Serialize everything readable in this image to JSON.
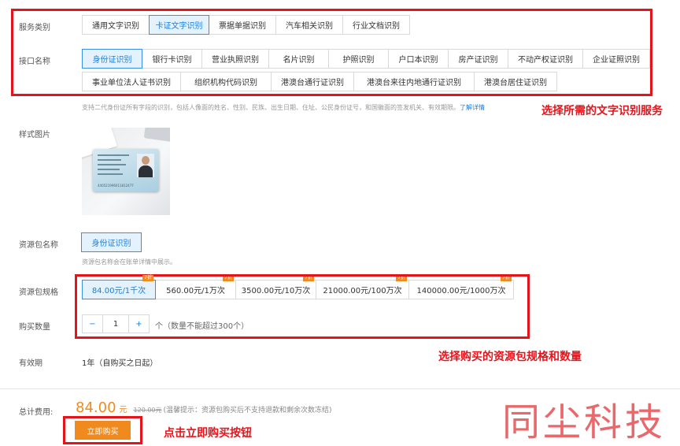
{
  "service_type": {
    "label": "服务类别",
    "tabs": [
      "通用文字识别",
      "卡证文字识别",
      "票据单据识别",
      "汽车相关识别",
      "行业文档识别"
    ],
    "active": 1
  },
  "api_name": {
    "label": "接口名称",
    "row1": [
      "身份证识别",
      "银行卡识别",
      "营业执照识别",
      "名片识别",
      "护照识别",
      "户口本识别",
      "房产证识别",
      "不动产权证识别",
      "企业证照识别"
    ],
    "row2": [
      "事业单位法人证书识别",
      "组织机构代码识别",
      "港澳台通行证识别",
      "港澳台来往内地通行证识别",
      "港澳台居住证识别"
    ],
    "active": 0,
    "hint": "支持二代身份证所有字段的识别，包括人像面的姓名、性别、民族、出生日期、住址、公民身份证号，和国徽面的签发机关、有效期限。",
    "hint_link": "了解详情"
  },
  "sample_image": {
    "label": "样式图片",
    "card_number": "440521996011812477"
  },
  "package_name": {
    "label": "资源包名称",
    "value": "身份证识别",
    "hint": "资源包名称会在账单详情中展示。"
  },
  "package_spec": {
    "label": "资源包规格",
    "options": [
      {
        "text": "84.00元/1千次",
        "badge": "7折"
      },
      {
        "text": "560.00元/1万次",
        "badge": "7折"
      },
      {
        "text": "3500.00元/10万次",
        "badge": "7折"
      },
      {
        "text": "21000.00元/100万次",
        "badge": "7折"
      },
      {
        "text": "140000.00元/1000万次",
        "badge": "7折"
      }
    ],
    "active": 0
  },
  "quantity": {
    "label": "购买数量",
    "minus": "−",
    "value": "1",
    "plus": "+",
    "unit_note": "个（数量不能超过300个）"
  },
  "validity": {
    "label": "有效期",
    "value": "1年（自购买之日起）"
  },
  "total": {
    "label": "总计费用:",
    "amount": "84.00",
    "unit": "元",
    "original": "120.00元",
    "note": "(温馨提示：资源包购买后不支持退款和剩余次数冻结)"
  },
  "buy_button": "立即购买",
  "annotations": {
    "select_service": "选择所需的文字识别服务",
    "select_spec": "选择购买的资源包规格和数量",
    "click_buy": "点击立即购买按钮"
  },
  "watermark": "同尘科技",
  "colors": {
    "accent_blue": "#1a7fe0",
    "active_bg": "#e3f2fd",
    "orange": "#f08a1e",
    "annotation_red": "#e5141b"
  }
}
